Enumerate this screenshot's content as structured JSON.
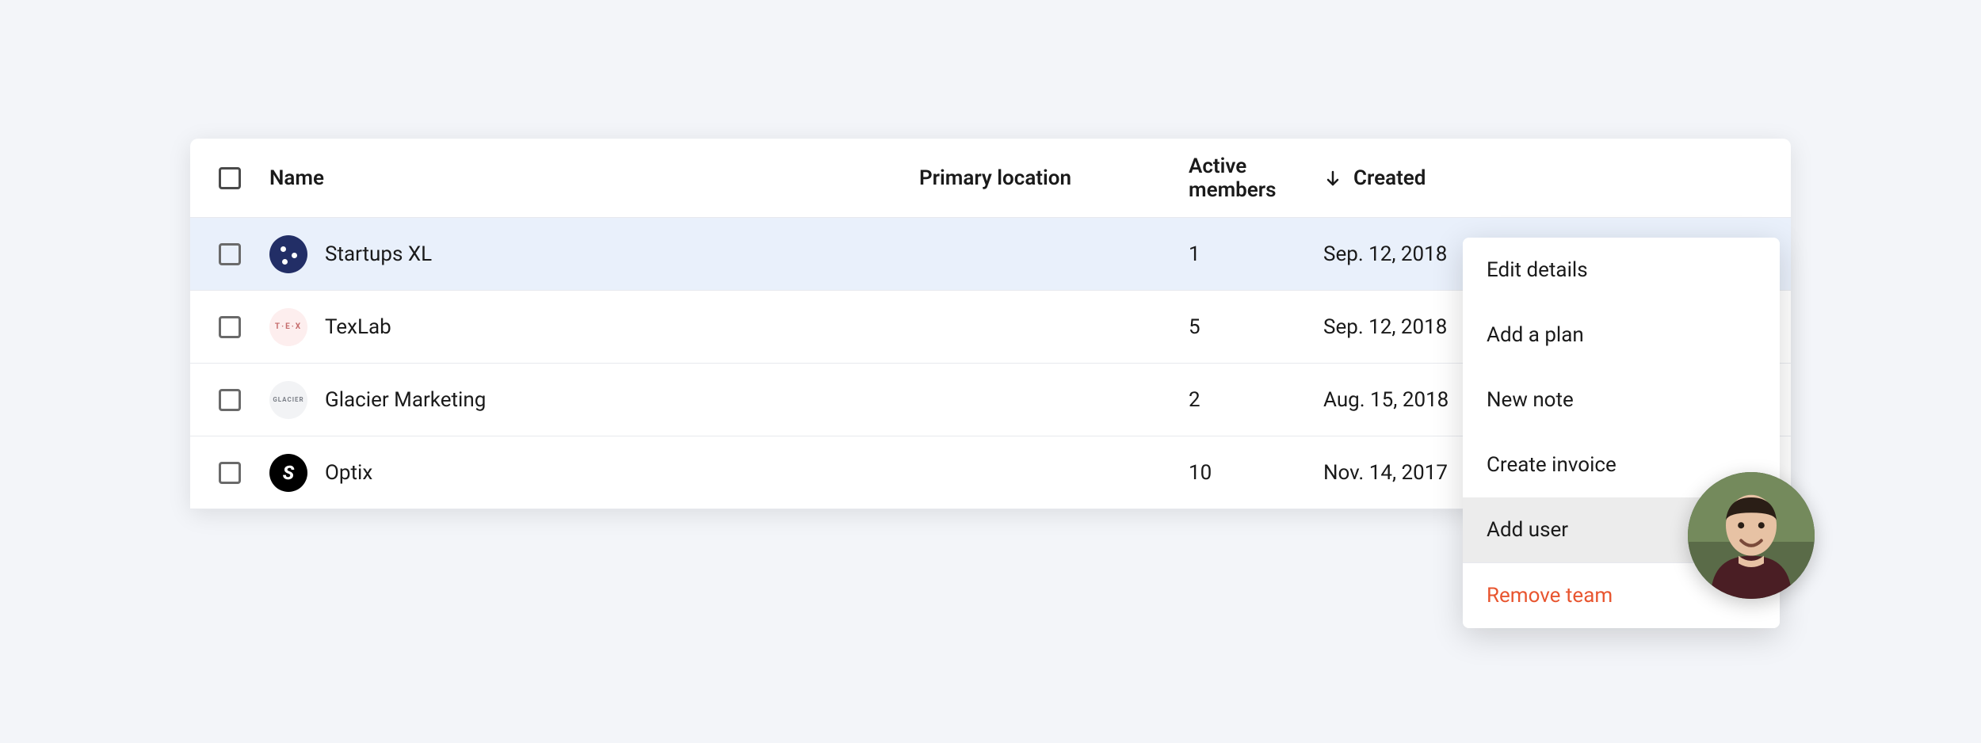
{
  "columns": {
    "name": "Name",
    "primary_location": "Primary location",
    "active_members": "Active members",
    "created": "Created"
  },
  "sort": {
    "column": "created",
    "direction": "desc"
  },
  "rows": [
    {
      "selected": true,
      "logo_style": "navy",
      "logo_text": "",
      "name": "Startups XL",
      "primary_location": "",
      "active_members": "1",
      "created": "Sep. 12, 2018"
    },
    {
      "selected": false,
      "logo_style": "pink",
      "logo_text": "T·E·X",
      "name": "TexLab",
      "primary_location": "",
      "active_members": "5",
      "created": "Sep. 12, 2018"
    },
    {
      "selected": false,
      "logo_style": "gray",
      "logo_text": "GLACIER",
      "name": "Glacier Marketing",
      "primary_location": "",
      "active_members": "2",
      "created": "Aug. 15, 2018"
    },
    {
      "selected": false,
      "logo_style": "black",
      "logo_text": "S",
      "name": "Optix",
      "primary_location": "",
      "active_members": "10",
      "created": "Nov. 14, 2017"
    }
  ],
  "menu": {
    "edit_details": "Edit details",
    "add_plan": "Add a plan",
    "new_note": "New note",
    "create_invoice": "Create invoice",
    "add_user": "Add user",
    "remove_team": "Remove team"
  }
}
